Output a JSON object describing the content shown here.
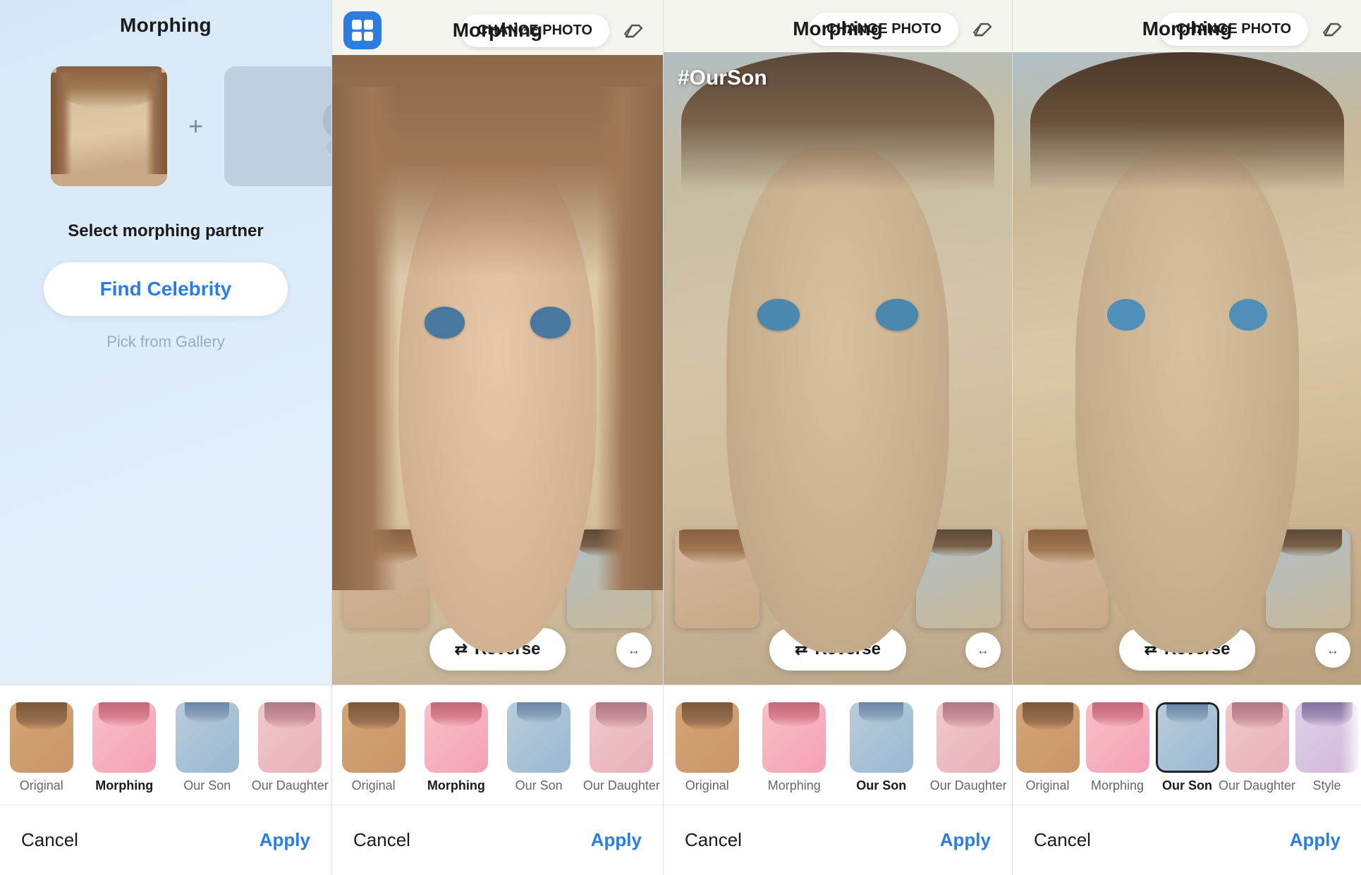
{
  "panel1": {
    "title": "Morphing",
    "select_partner_label": "Select morphing partner",
    "find_celebrity_label": "Find Celebrity",
    "pick_gallery_label": "Pick from Gallery",
    "cancel_label": "Cancel",
    "apply_label": "Apply",
    "tabs": [
      {
        "label": "Original",
        "active": false,
        "key": "original"
      },
      {
        "label": "Morphing",
        "active": true,
        "key": "morphing"
      },
      {
        "label": "Our Son",
        "active": false,
        "key": "ourson"
      },
      {
        "label": "Our Daughter",
        "active": false,
        "key": "daughter"
      }
    ]
  },
  "panel2": {
    "title": "Morphing",
    "change_photo_label": "CHANGE PHOTO",
    "reverse_label": "Reverse",
    "cancel_label": "Cancel",
    "apply_label": "Apply",
    "tabs": [
      {
        "label": "Original",
        "active": false,
        "key": "original"
      },
      {
        "label": "Morphing",
        "active": true,
        "key": "morphing"
      },
      {
        "label": "Our Son",
        "active": false,
        "key": "ourson"
      },
      {
        "label": "Our Daughter",
        "active": false,
        "key": "daughter"
      }
    ]
  },
  "panel3a": {
    "title": "Morphing",
    "change_photo_label": "CHANGE PHOTO",
    "reverse_label": "Reverse",
    "cancel_label": "Cancel",
    "apply_label": "Apply",
    "hashtag": "#OurSon",
    "tabs": [
      {
        "label": "Original",
        "active": false,
        "key": "original"
      },
      {
        "label": "Morphing",
        "active": false,
        "key": "morphing"
      },
      {
        "label": "Our Son",
        "active": true,
        "key": "ourson"
      },
      {
        "label": "Our Daughter",
        "active": false,
        "key": "daughter"
      }
    ]
  },
  "panel3b": {
    "title": "Morphing",
    "change_photo_label": "CHANGE PHOTO",
    "reverse_label": "Reverse",
    "cancel_label": "Cancel",
    "apply_label": "Apply",
    "tabs": [
      {
        "label": "Original",
        "active": false,
        "key": "original"
      },
      {
        "label": "Morphing",
        "active": false,
        "key": "morphing"
      },
      {
        "label": "Our Son",
        "active": false,
        "key": "ourson"
      },
      {
        "label": "Our Daughter",
        "active": false,
        "key": "daughter"
      },
      {
        "label": "Style",
        "active": false,
        "key": "style"
      }
    ]
  },
  "icons": {
    "grid": "⊞",
    "reverse": "↺",
    "expand": "↔",
    "eraser": "✎",
    "change_arrows": "⇄"
  }
}
